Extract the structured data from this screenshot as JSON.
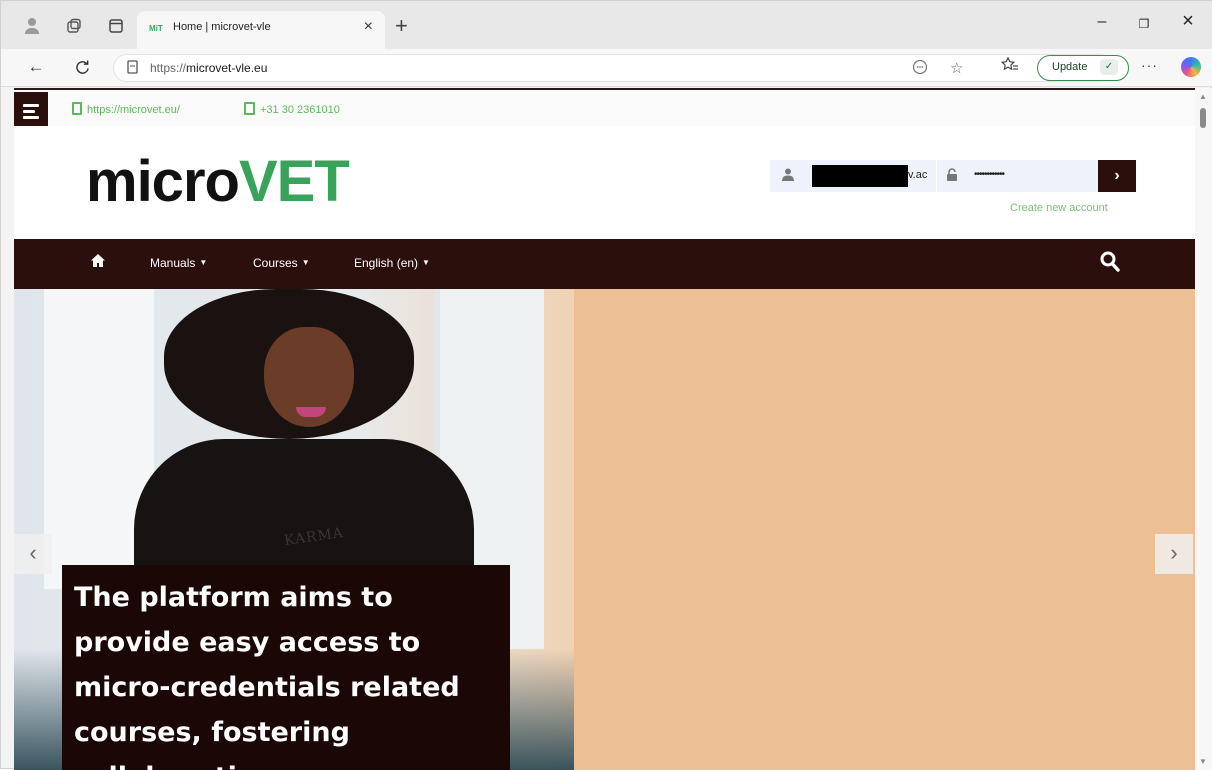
{
  "browser": {
    "tab_title": "Home | microvet-vle",
    "tab_favicon_text": "MiT",
    "url_prefix": "https://",
    "url_host": "microvet-vle.eu",
    "update_label": "Update",
    "window_minimize": "–",
    "window_restore": "❐",
    "window_close": "×"
  },
  "infobar": {
    "website": "https://microvet.eu/",
    "phone": "+31 30 2361010"
  },
  "header": {
    "logo_left": "micro",
    "logo_right": "VET",
    "username_tail": "v.ac",
    "password_mask": "••••••••••••",
    "login_arrow": "›",
    "create_account": "Create new account"
  },
  "nav": {
    "items": [
      {
        "label": "Manuals"
      },
      {
        "label": "Courses"
      },
      {
        "label": "English (en)"
      }
    ]
  },
  "hero": {
    "shirt_text": "KARMA",
    "caption": "The platform aims to provide easy access to micro-credentials related courses, fostering collaboration among users",
    "prev": "‹",
    "next": "›"
  },
  "colors": {
    "brand_dark": "#2b0f0d",
    "brand_green": "#3aa35a",
    "hero_peach": "#edbf94"
  }
}
